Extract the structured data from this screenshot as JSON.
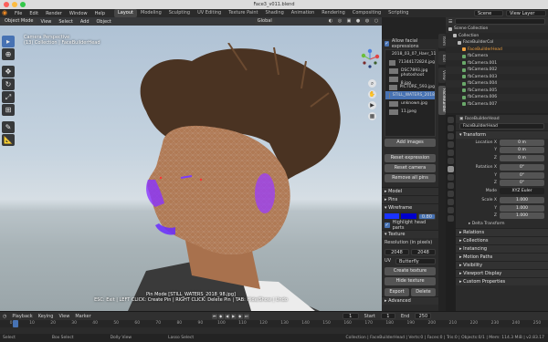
{
  "window": {
    "title": "Face3_v011.blend"
  },
  "menu": [
    "File",
    "Edit",
    "Render",
    "Window",
    "Help"
  ],
  "workspaces": [
    {
      "label": "Layout",
      "active": true
    },
    {
      "label": "Modeling"
    },
    {
      "label": "Sculpting"
    },
    {
      "label": "UV Editing"
    },
    {
      "label": "Texture Paint"
    },
    {
      "label": "Shading"
    },
    {
      "label": "Animation"
    },
    {
      "label": "Rendering"
    },
    {
      "label": "Compositing"
    },
    {
      "label": "Scripting"
    }
  ],
  "topbar_right": {
    "options": "Options",
    "scene": "Scene",
    "view_layer": "View Layer"
  },
  "viewport": {
    "mode": "Object Mode",
    "menus": [
      "View",
      "Select",
      "Add",
      "Object"
    ],
    "orientation": "Global",
    "info_line1": "Camera Perspective",
    "info_line2": "(13) Collection | FaceBuilderHead",
    "caption_line1": "Pin Mode [STILL_WATERS_2018_98.jpg]",
    "caption_line2": "ESC: Exit | LEFT CLICK: Create Pin | RIGHT CLICK: Delete Pin | TAB: Hide/Show | Undo"
  },
  "npanel": {
    "allow_label": "Allow facial expressions",
    "images": [
      {
        "label": "2018_03_07_Haer_11"
      },
      {
        "label": "71344172824.jpg"
      },
      {
        "label": "DSC7893.jpg"
      },
      {
        "label": "photoshoot 8.jpg"
      },
      {
        "label": "PICTURE_593.jpg"
      },
      {
        "label": "STILL_WATERS_2018",
        "selected": true
      },
      {
        "label": "unknown.jpg"
      },
      {
        "label": "11.jpeg"
      }
    ],
    "add_images": "Add images",
    "reset_expression": "Reset expression",
    "reset_camera": "Reset camera",
    "remove_all_pins": "Remove all pins",
    "sections": {
      "model": "Model",
      "pins": "Pins",
      "wireframe": "Wireframe",
      "texture": "Texture",
      "advanced": "Advanced"
    },
    "wire_value": "0.80",
    "highlight": "Highlight head parts",
    "resolution_label": "Resolution (in pixels)",
    "res_w": "2048",
    "res_h": "2048",
    "uv_label": "UV",
    "uv_value": "Butterfly",
    "create_texture": "Create texture",
    "hide_texture": "Hide texture",
    "export": "Export",
    "delete": "Delete",
    "tabs": [
      {
        "label": "Item"
      },
      {
        "label": "Tool"
      },
      {
        "label": "View"
      },
      {
        "label": "FaceBuilder",
        "active": true
      }
    ]
  },
  "outliner": {
    "title": "Scene Collection",
    "rows": [
      {
        "label": "Collection",
        "indent": 1
      },
      {
        "label": "FaceBuilderCol",
        "indent": 2
      },
      {
        "label": "FaceBuilderHead",
        "indent": 3
      },
      {
        "label": "fbCamera",
        "indent": 3
      },
      {
        "label": "fbCamera.001",
        "indent": 3
      },
      {
        "label": "fbCamera.002",
        "indent": 3
      },
      {
        "label": "fbCamera.003",
        "indent": 3
      },
      {
        "label": "fbCamera.004",
        "indent": 3
      },
      {
        "label": "fbCamera.005",
        "indent": 3
      },
      {
        "label": "fbCamera.006",
        "indent": 3
      },
      {
        "label": "fbCamera.007",
        "indent": 3
      }
    ]
  },
  "properties": {
    "object": "FaceBuilderHead",
    "name_field": "FaceBuilderHead",
    "transform": "Transform",
    "location": {
      "label": "Location X",
      "x": "0 m",
      "y": "0 m",
      "z": "0 m"
    },
    "rotation": {
      "label": "Rotation X",
      "x": "0°",
      "y": "0°",
      "z": "0°"
    },
    "mode_label": "Mode",
    "mode_value": "XYZ Euler",
    "scale": {
      "label": "Scale X",
      "x": "1.000",
      "y": "1.000",
      "z": "1.000"
    },
    "y_label": "Y",
    "z_label": "Z",
    "sections": [
      "Delta Transform",
      "Relations",
      "Collections",
      "Instancing",
      "Motion Paths",
      "Visibility",
      "Viewport Display",
      "Custom Properties"
    ]
  },
  "timeline": {
    "playback": "Playback",
    "keying": "Keying",
    "view": "View",
    "marker": "Marker",
    "current_frame": "1",
    "start_label": "Start",
    "start": "1",
    "end_label": "End",
    "end": "250",
    "ticks": [
      "0",
      "10",
      "20",
      "30",
      "40",
      "50",
      "60",
      "70",
      "80",
      "90",
      "100",
      "110",
      "120",
      "130",
      "140",
      "150",
      "160",
      "170",
      "180",
      "190",
      "200",
      "210",
      "220",
      "230",
      "240",
      "250"
    ]
  },
  "status": {
    "left": "Select",
    "box": "Box Select",
    "dolly": "Dolly View",
    "lasso": "Lasso Select",
    "right": "Collection | FaceBuilderHead | Verts:0 | Faces:0 | Tris:0 | Objects:0/1 | Mem: 114.3 MiB | v2.83.17"
  }
}
